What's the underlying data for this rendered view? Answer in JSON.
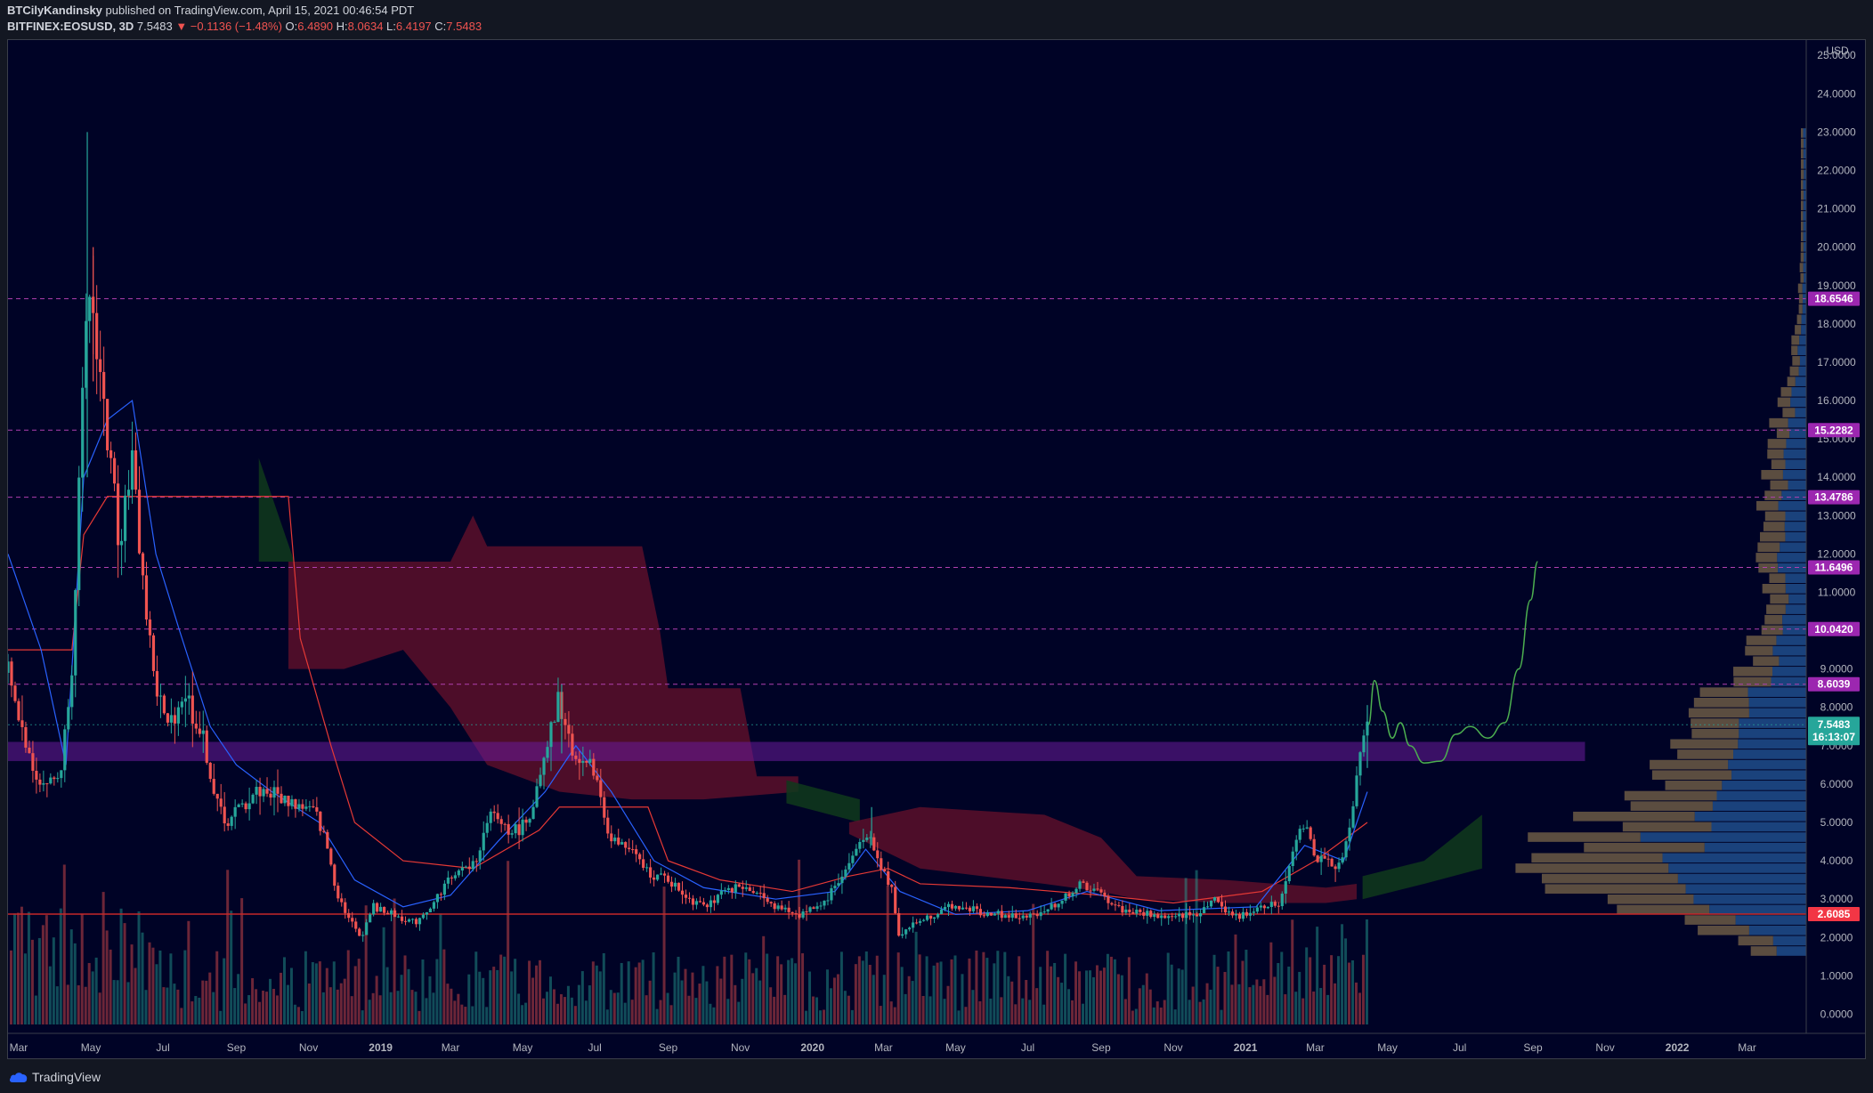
{
  "header": {
    "author": "BTCilyKandinsky",
    "published_text": "published on TradingView.com, April 15, 2021 00:46:54 PDT",
    "symbol": "BITFINEX:EOSUSD, 3D",
    "last": "7.5483",
    "change": "▼ −0.1136 (−1.48%)",
    "o_label": "O:",
    "o_value": "6.4890",
    "h_label": "H:",
    "h_value": "8.0634",
    "l_label": "L:",
    "l_value": "6.4197",
    "c_label": "C:",
    "c_value": "7.5483"
  },
  "footer": {
    "brand": "TradingView"
  },
  "colors": {
    "background": "#000326",
    "up": "#26a69a",
    "down": "#ef5350",
    "level_line": "#b040b0",
    "level_tag": "#9c27b0",
    "price_tag": "#26a69a",
    "support_tag": "#f23645",
    "kijun": "#e53935",
    "tenkan": "#2962ff",
    "cloud_bear": "#5a0f2a",
    "cloud_bull": "#0f3a1c",
    "zone": "#6a1b9a",
    "projection": "#4caf50",
    "vp_up": "#1e4d8c",
    "vp_down": "#6b5a45"
  },
  "chart_data": {
    "type": "candlestick",
    "title": "BITFINEX:EOSUSD, 3D",
    "currency": "USD",
    "ylim": [
      -0.5,
      25.4
    ],
    "y_ticks": [
      "0.0000",
      "1.0000",
      "2.0000",
      "3.0000",
      "4.0000",
      "5.0000",
      "6.0000",
      "7.0000",
      "8.0000",
      "9.0000",
      "10.0000",
      "11.0000",
      "12.0000",
      "13.0000",
      "14.0000",
      "15.0000",
      "16.0000",
      "17.0000",
      "18.0000",
      "19.0000",
      "20.0000",
      "21.0000",
      "22.0000",
      "23.0000",
      "24.0000",
      "25.0000"
    ],
    "x_ticks": [
      "Mar",
      "May",
      "Jul",
      "Sep",
      "Nov",
      "2019",
      "Mar",
      "May",
      "Jul",
      "Sep",
      "Nov",
      "2020",
      "Mar",
      "May",
      "Jul",
      "Sep",
      "Nov",
      "2021",
      "Mar",
      "May",
      "Jul",
      "Sep",
      "Nov",
      "2022",
      "Mar"
    ],
    "x_tick_dates": [
      "2018-03-01",
      "2018-05-01",
      "2018-07-01",
      "2018-09-01",
      "2018-11-01",
      "2019-01-01",
      "2019-03-01",
      "2019-05-01",
      "2019-07-01",
      "2019-09-01",
      "2019-11-01",
      "2020-01-01",
      "2020-03-01",
      "2020-05-01",
      "2020-07-01",
      "2020-09-01",
      "2020-11-01",
      "2021-01-01",
      "2021-03-01",
      "2021-05-01",
      "2021-07-01",
      "2021-09-01",
      "2021-11-01",
      "2022-01-01",
      "2022-03-01"
    ],
    "x_range": [
      "2018-02-20",
      "2022-04-20"
    ],
    "last_price": {
      "value": 7.5483,
      "label": "7.5483",
      "countdown": "16:13:07"
    },
    "levels": [
      {
        "value": 18.6546,
        "label": "18.6546"
      },
      {
        "value": 15.2282,
        "label": "15.2282"
      },
      {
        "value": 13.4786,
        "label": "13.4786"
      },
      {
        "value": 11.6496,
        "label": "11.6496"
      },
      {
        "value": 10.042,
        "label": "10.0420"
      },
      {
        "value": 8.6039,
        "label": "8.6039"
      }
    ],
    "support": {
      "value": 2.6085,
      "label": "2.6085"
    },
    "zone": {
      "low": 6.6,
      "high": 7.1,
      "start": "2018-02-20",
      "end": "2021-10-15"
    },
    "price_path": [
      [
        "2018-02-20",
        8.9
      ],
      [
        "2018-03-05",
        7.2
      ],
      [
        "2018-03-20",
        6.0
      ],
      [
        "2018-04-05",
        6.2
      ],
      [
        "2018-04-15",
        9.0
      ],
      [
        "2018-04-22",
        14.5
      ],
      [
        "2018-04-29",
        19.0
      ],
      [
        "2018-05-06",
        17.5
      ],
      [
        "2018-05-15",
        15.0
      ],
      [
        "2018-05-25",
        12.5
      ],
      [
        "2018-06-05",
        14.5
      ],
      [
        "2018-06-15",
        11.0
      ],
      [
        "2018-06-25",
        8.5
      ],
      [
        "2018-07-05",
        7.5
      ],
      [
        "2018-07-20",
        8.4
      ],
      [
        "2018-08-05",
        7.0
      ],
      [
        "2018-08-15",
        5.5
      ],
      [
        "2018-08-25",
        5.0
      ],
      [
        "2018-09-05",
        5.4
      ],
      [
        "2018-09-20",
        5.9
      ],
      [
        "2018-10-05",
        5.7
      ],
      [
        "2018-10-20",
        5.5
      ],
      [
        "2018-11-05",
        5.3
      ],
      [
        "2018-11-15",
        4.6
      ],
      [
        "2018-11-25",
        3.2
      ],
      [
        "2018-12-05",
        2.5
      ],
      [
        "2018-12-15",
        2.0
      ],
      [
        "2018-12-25",
        2.8
      ],
      [
        "2019-01-10",
        2.6
      ],
      [
        "2019-01-30",
        2.4
      ],
      [
        "2019-02-15",
        2.9
      ],
      [
        "2019-03-01",
        3.6
      ],
      [
        "2019-03-20",
        3.9
      ],
      [
        "2019-04-05",
        5.2
      ],
      [
        "2019-04-20",
        4.8
      ],
      [
        "2019-05-05",
        5.0
      ],
      [
        "2019-05-20",
        6.6
      ],
      [
        "2019-06-01",
        8.2
      ],
      [
        "2019-06-10",
        6.9
      ],
      [
        "2019-06-20",
        6.6
      ],
      [
        "2019-07-01",
        6.3
      ],
      [
        "2019-07-15",
        4.5
      ],
      [
        "2019-07-30",
        4.3
      ],
      [
        "2019-08-15",
        3.7
      ],
      [
        "2019-09-01",
        3.5
      ],
      [
        "2019-09-20",
        3.0
      ],
      [
        "2019-10-05",
        2.9
      ],
      [
        "2019-10-25",
        3.3
      ],
      [
        "2019-11-15",
        3.2
      ],
      [
        "2019-12-01",
        2.8
      ],
      [
        "2019-12-20",
        2.6
      ],
      [
        "2020-01-10",
        2.9
      ],
      [
        "2020-01-30",
        3.8
      ],
      [
        "2020-02-15",
        4.8
      ],
      [
        "2020-02-25",
        4.0
      ],
      [
        "2020-03-08",
        3.3
      ],
      [
        "2020-03-14",
        2.1
      ],
      [
        "2020-03-25",
        2.3
      ],
      [
        "2020-04-10",
        2.6
      ],
      [
        "2020-05-01",
        2.8
      ],
      [
        "2020-06-01",
        2.6
      ],
      [
        "2020-07-01",
        2.5
      ],
      [
        "2020-08-01",
        3.0
      ],
      [
        "2020-08-15",
        3.4
      ],
      [
        "2020-09-01",
        3.1
      ],
      [
        "2020-09-20",
        2.7
      ],
      [
        "2020-10-10",
        2.6
      ],
      [
        "2020-10-30",
        2.5
      ],
      [
        "2020-11-20",
        2.6
      ],
      [
        "2020-12-05",
        3.0
      ],
      [
        "2020-12-25",
        2.5
      ],
      [
        "2021-01-10",
        2.8
      ],
      [
        "2021-01-30",
        2.9
      ],
      [
        "2021-02-10",
        4.3
      ],
      [
        "2021-02-20",
        5.0
      ],
      [
        "2021-03-01",
        4.1
      ],
      [
        "2021-03-15",
        3.9
      ],
      [
        "2021-03-25",
        4.2
      ],
      [
        "2021-04-01",
        5.0
      ],
      [
        "2021-04-06",
        6.4
      ],
      [
        "2021-04-10",
        7.2
      ],
      [
        "2021-04-14",
        7.55
      ]
    ],
    "projection": [
      [
        "2021-04-15",
        7.55
      ],
      [
        "2021-04-20",
        8.7
      ],
      [
        "2021-04-27",
        7.9
      ],
      [
        "2021-05-05",
        7.2
      ],
      [
        "2021-05-12",
        7.6
      ],
      [
        "2021-05-20",
        7.0
      ],
      [
        "2021-06-01",
        6.55
      ],
      [
        "2021-06-15",
        6.6
      ],
      [
        "2021-06-28",
        7.3
      ],
      [
        "2021-07-10",
        7.5
      ],
      [
        "2021-07-25",
        7.2
      ],
      [
        "2021-08-08",
        7.6
      ],
      [
        "2021-08-20",
        9.0
      ],
      [
        "2021-08-30",
        10.8
      ],
      [
        "2021-09-05",
        11.8
      ]
    ],
    "kijun": [
      [
        "2018-02-20",
        9.5
      ],
      [
        "2018-04-15",
        9.5
      ],
      [
        "2018-04-25",
        12.5
      ],
      [
        "2018-05-15",
        13.5
      ],
      [
        "2018-10-15",
        13.5
      ],
      [
        "2018-10-25",
        9.8
      ],
      [
        "2018-11-20",
        7.0
      ],
      [
        "2018-12-10",
        5.0
      ],
      [
        "2019-01-20",
        4.0
      ],
      [
        "2019-03-20",
        3.8
      ],
      [
        "2019-05-15",
        4.8
      ],
      [
        "2019-06-01",
        5.4
      ],
      [
        "2019-08-15",
        5.4
      ],
      [
        "2019-09-01",
        4.0
      ],
      [
        "2019-10-15",
        3.5
      ],
      [
        "2019-12-15",
        3.2
      ],
      [
        "2020-02-01",
        3.6
      ],
      [
        "2020-03-05",
        3.8
      ],
      [
        "2020-04-01",
        3.4
      ],
      [
        "2020-06-15",
        3.3
      ],
      [
        "2020-09-01",
        3.1
      ],
      [
        "2020-11-01",
        2.9
      ],
      [
        "2021-01-15",
        3.2
      ],
      [
        "2021-03-01",
        4.0
      ],
      [
        "2021-04-14",
        5.0
      ]
    ],
    "tenkan": [
      [
        "2018-02-20",
        12.0
      ],
      [
        "2018-03-20",
        9.5
      ],
      [
        "2018-04-10",
        6.5
      ],
      [
        "2018-04-25",
        14.0
      ],
      [
        "2018-05-15",
        15.5
      ],
      [
        "2018-06-05",
        16.0
      ],
      [
        "2018-06-25",
        12.0
      ],
      [
        "2018-07-15",
        10.0
      ],
      [
        "2018-08-10",
        7.5
      ],
      [
        "2018-09-01",
        6.5
      ],
      [
        "2018-10-01",
        5.8
      ],
      [
        "2018-11-10",
        5.0
      ],
      [
        "2018-12-10",
        3.5
      ],
      [
        "2019-01-20",
        2.8
      ],
      [
        "2019-03-01",
        3.1
      ],
      [
        "2019-04-10",
        4.5
      ],
      [
        "2019-05-20",
        5.8
      ],
      [
        "2019-06-15",
        7.0
      ],
      [
        "2019-07-15",
        5.8
      ],
      [
        "2019-08-20",
        4.0
      ],
      [
        "2019-10-01",
        3.3
      ],
      [
        "2019-12-01",
        3.0
      ],
      [
        "2020-01-20",
        3.2
      ],
      [
        "2020-02-15",
        4.3
      ],
      [
        "2020-03-15",
        3.2
      ],
      [
        "2020-05-01",
        2.6
      ],
      [
        "2020-07-01",
        2.7
      ],
      [
        "2020-08-20",
        3.2
      ],
      [
        "2020-10-20",
        2.7
      ],
      [
        "2021-01-10",
        2.8
      ],
      [
        "2021-02-20",
        4.4
      ],
      [
        "2021-03-25",
        4.0
      ],
      [
        "2021-04-14",
        5.8
      ]
    ],
    "clouds": [
      {
        "kind": "bear",
        "top": [
          [
            "2018-10-15",
            11.8
          ],
          [
            "2019-03-01",
            11.8
          ],
          [
            "2019-03-20",
            13.0
          ],
          [
            "2019-04-01",
            12.2
          ],
          [
            "2019-08-10",
            12.2
          ],
          [
            "2019-08-25",
            10.0
          ],
          [
            "2019-09-01",
            8.5
          ],
          [
            "2019-11-01",
            8.5
          ],
          [
            "2019-11-15",
            6.2
          ],
          [
            "2019-12-20",
            6.2
          ]
        ],
        "bottom": [
          [
            "2018-10-15",
            9.0
          ],
          [
            "2018-12-01",
            9.0
          ],
          [
            "2019-01-20",
            9.5
          ],
          [
            "2019-03-01",
            8.0
          ],
          [
            "2019-04-01",
            6.5
          ],
          [
            "2019-06-01",
            5.8
          ],
          [
            "2019-08-01",
            5.6
          ],
          [
            "2019-10-01",
            5.6
          ],
          [
            "2019-12-20",
            5.8
          ]
        ]
      },
      {
        "kind": "bull",
        "top": [
          [
            "2018-09-20",
            14.5
          ],
          [
            "2018-10-20",
            11.8
          ]
        ],
        "bottom": [
          [
            "2018-09-20",
            11.8
          ],
          [
            "2018-10-20",
            11.8
          ]
        ]
      },
      {
        "kind": "bull",
        "top": [
          [
            "2019-12-10",
            6.1
          ],
          [
            "2020-02-10",
            5.6
          ]
        ],
        "bottom": [
          [
            "2019-12-10",
            5.5
          ],
          [
            "2020-02-10",
            5.0
          ]
        ]
      },
      {
        "kind": "bear",
        "top": [
          [
            "2020-02-01",
            5.0
          ],
          [
            "2020-04-01",
            5.4
          ],
          [
            "2020-07-15",
            5.2
          ],
          [
            "2020-09-01",
            4.6
          ],
          [
            "2020-10-01",
            3.6
          ],
          [
            "2020-12-15",
            3.5
          ],
          [
            "2021-03-10",
            3.3
          ],
          [
            "2021-04-05",
            3.4
          ]
        ],
        "bottom": [
          [
            "2020-02-01",
            4.7
          ],
          [
            "2020-04-01",
            3.8
          ],
          [
            "2020-07-15",
            3.4
          ],
          [
            "2020-09-01",
            3.2
          ],
          [
            "2020-10-01",
            3.0
          ],
          [
            "2020-12-15",
            2.9
          ],
          [
            "2021-03-10",
            2.9
          ],
          [
            "2021-04-05",
            3.0
          ]
        ]
      },
      {
        "kind": "bull",
        "top": [
          [
            "2021-04-10",
            3.6
          ],
          [
            "2021-06-01",
            4.0
          ],
          [
            "2021-07-20",
            5.2
          ]
        ],
        "bottom": [
          [
            "2021-04-10",
            3.0
          ],
          [
            "2021-06-01",
            3.4
          ],
          [
            "2021-07-20",
            3.8
          ]
        ]
      }
    ]
  }
}
